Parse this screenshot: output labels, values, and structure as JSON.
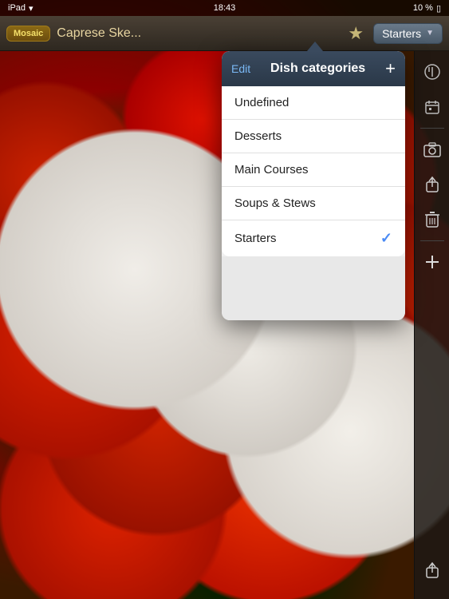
{
  "status_bar": {
    "carrier": "iPad",
    "time": "18:43",
    "battery": "10 %"
  },
  "nav": {
    "badge_label": "Mosaic",
    "title": "Caprese Ske...",
    "star_icon": "★",
    "dropdown_label": "Starters",
    "dropdown_arrow": "▼"
  },
  "dropdown": {
    "title": "Dish categories",
    "edit_label": "Edit",
    "plus_label": "+",
    "items": [
      {
        "label": "Undefined",
        "selected": false
      },
      {
        "label": "Desserts",
        "selected": false
      },
      {
        "label": "Main Courses",
        "selected": false
      },
      {
        "label": "Soups & Stews",
        "selected": false
      },
      {
        "label": "Starters",
        "selected": true
      }
    ],
    "check_mark": "✓"
  },
  "toolbar": {
    "top_icons": [
      {
        "name": "utensils-icon",
        "symbol": "🍴",
        "label": "utensils"
      },
      {
        "name": "calendar-icon",
        "symbol": "📅",
        "label": "calendar"
      }
    ],
    "camera_label": "📷",
    "share_label": "⬆",
    "trash_label": "🗑",
    "plus_label": "+",
    "share_bottom_label": "⬆"
  }
}
